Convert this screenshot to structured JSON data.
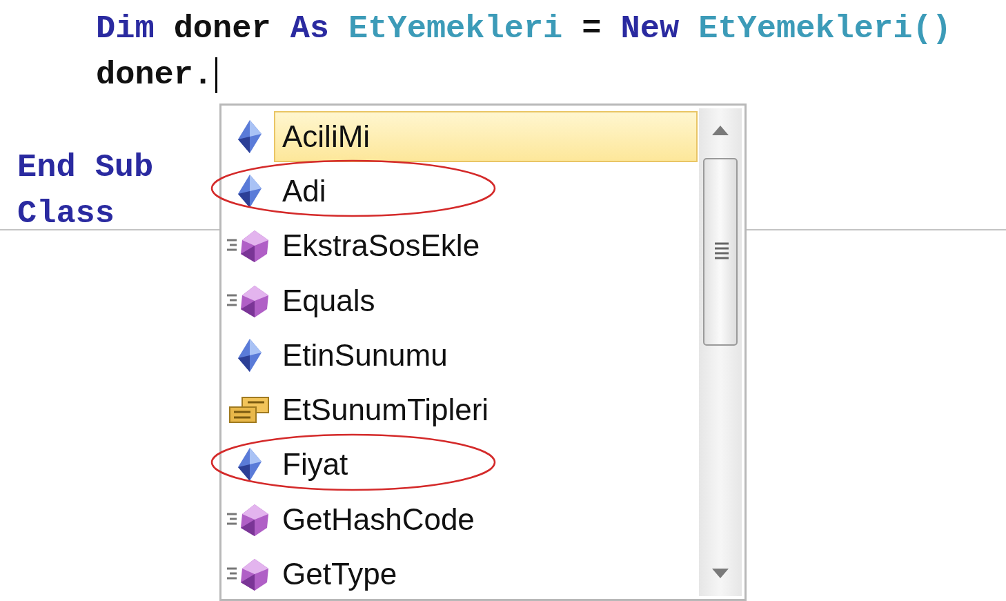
{
  "code_lines": [
    {
      "indented": true,
      "tokens": [
        {
          "kind": "keyword",
          "text": "Dim"
        },
        {
          "kind": "plain",
          "text": "doner"
        },
        {
          "kind": "keyword",
          "text": "As"
        },
        {
          "kind": "type",
          "text": "EtYemekleri"
        },
        {
          "kind": "plain",
          "text": "="
        },
        {
          "kind": "keyword",
          "text": "New"
        },
        {
          "kind": "type",
          "text": "EtYemekleri()"
        }
      ]
    },
    {
      "indented": true,
      "caret": true,
      "tokens": [
        {
          "kind": "plain",
          "text": "doner."
        }
      ]
    },
    {
      "indented": false,
      "tokens": [
        {
          "kind": "keyword",
          "text": "End"
        },
        {
          "kind": "keyword",
          "text": "Sub"
        }
      ]
    },
    {
      "indented": false,
      "tokens": [
        {
          "kind": "keyword",
          "text": "Class"
        }
      ]
    }
  ],
  "completion_list": {
    "items": [
      {
        "kind": "property",
        "label": "AciliMi",
        "selected": true,
        "circled": false
      },
      {
        "kind": "property",
        "label": "Adi",
        "selected": false,
        "circled": true
      },
      {
        "kind": "method",
        "label": "EkstraSosEkle",
        "selected": false,
        "circled": false
      },
      {
        "kind": "method",
        "label": "Equals",
        "selected": false,
        "circled": false
      },
      {
        "kind": "property",
        "label": "EtinSunumu",
        "selected": false,
        "circled": false
      },
      {
        "kind": "enum",
        "label": "EtSunumTipleri",
        "selected": false,
        "circled": false
      },
      {
        "kind": "property",
        "label": "Fiyat",
        "selected": false,
        "circled": true
      },
      {
        "kind": "method",
        "label": "GetHashCode",
        "selected": false,
        "circled": false
      },
      {
        "kind": "method",
        "label": "GetType",
        "selected": false,
        "circled": false
      }
    ]
  }
}
